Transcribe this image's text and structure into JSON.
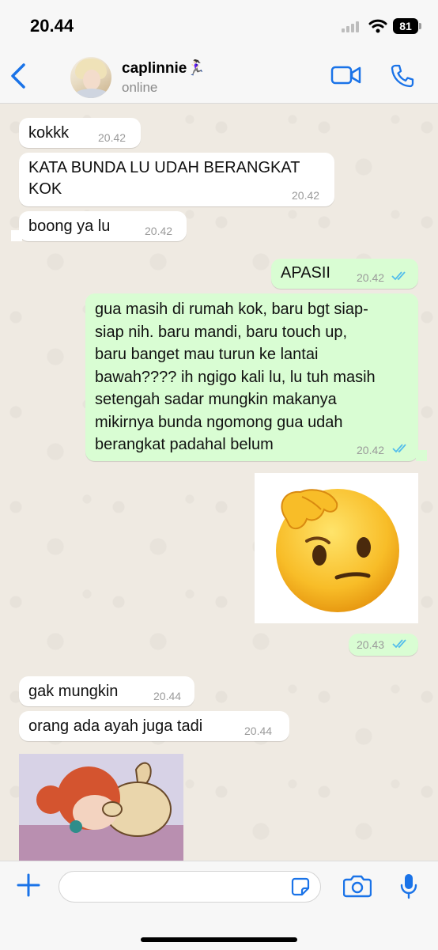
{
  "status_bar": {
    "time": "20.44",
    "battery": "81"
  },
  "header": {
    "contact_name": "caplinnie🏃🏻‍♀️",
    "status": "online"
  },
  "messages": [
    {
      "text": "kokkk",
      "time": "20.42"
    },
    {
      "text_lines": [
        "KATA BUNDA LU UDAH BERANGKAT",
        "KOK"
      ],
      "time": "20.42"
    },
    {
      "text": "boong ya lu",
      "time": "20.42"
    },
    {
      "text": "APASII",
      "time": "20.42"
    },
    {
      "text_lines": [
        "gua masih di rumah kok, baru bgt siap-",
        "siap nih. baru mandi, baru touch up,",
        "baru banget mau turun ke lantai",
        "bawah???? ih ngigo kali lu, lu tuh masih",
        "setengah sadar mungkin makanya",
        "mikirnya bunda ngomong gua udah",
        "berangkat padahal belum"
      ],
      "time": "20.42"
    },
    {
      "time": "20.43"
    },
    {
      "text": "gak mungkin",
      "time": "20.44"
    },
    {
      "text": "orang ada ayah juga tadi",
      "time": "20.44"
    }
  ],
  "composer": {
    "placeholder": ""
  },
  "colors": {
    "accent": "#1a73e8",
    "out_bubble": "#d9fdd3",
    "in_bubble": "#ffffff",
    "read_ticks": "#53bdeb"
  },
  "icons": [
    "back-chevron-icon",
    "video-call-icon",
    "phone-icon",
    "plus-icon",
    "sticker-icon",
    "camera-icon",
    "microphone-icon"
  ]
}
